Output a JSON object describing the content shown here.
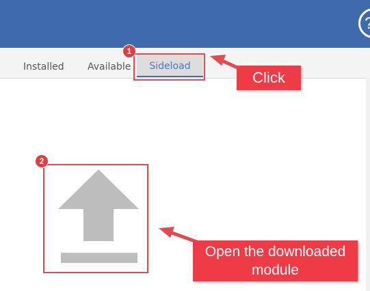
{
  "header": {
    "help_glyph": "?"
  },
  "tabs": {
    "installed": "Installed",
    "available": "Available",
    "sideload": "Sideload"
  },
  "annotations": {
    "step1": "1",
    "step2": "2",
    "click_callout": "Click",
    "open_callout_line1": "Open the downloaded",
    "open_callout_line2": "module"
  },
  "upload": {
    "icon": "upload-icon"
  },
  "colors": {
    "header": "#3f6aab",
    "accent": "#4c78b8",
    "annotation_red": "#e24a4f",
    "upload_gray": "#bdbdbd"
  }
}
